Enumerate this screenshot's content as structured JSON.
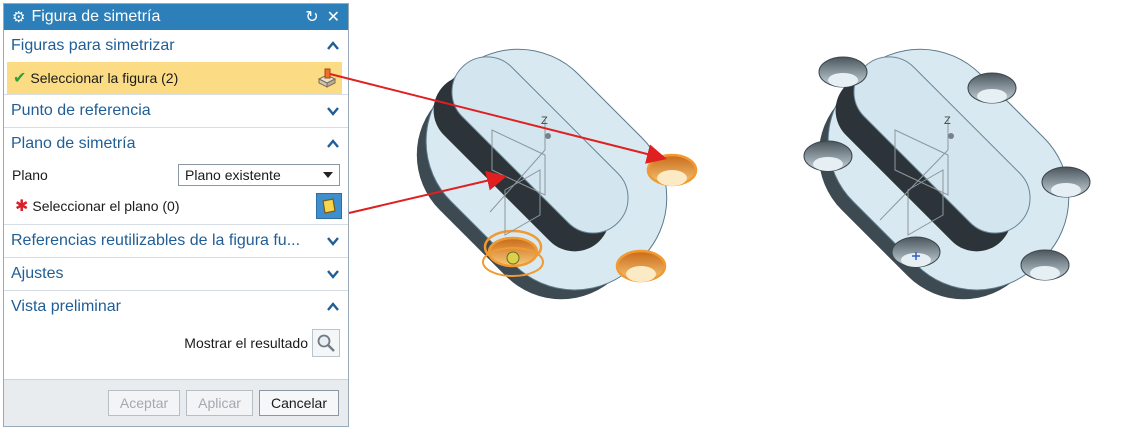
{
  "dialog": {
    "title": "Figura de simetría",
    "sections": {
      "figures": {
        "label": "Figuras para simetrizar",
        "select_label": "Seleccionar la figura (2)"
      },
      "reference_point": {
        "label": "Punto de referencia"
      },
      "symmetry_plane": {
        "label": "Plano de simetría",
        "plane_label": "Plano",
        "plane_value": "Plano existente",
        "select_label": "Seleccionar el plano (0)"
      },
      "reusable_refs": {
        "label": "Referencias reutilizables de la figura fu..."
      },
      "settings": {
        "label": "Ajustes"
      },
      "preview": {
        "label": "Vista preliminar",
        "show_result_label": "Mostrar el resultado"
      }
    },
    "buttons": {
      "accept": "Aceptar",
      "apply": "Aplicar",
      "cancel": "Cancelar"
    }
  },
  "viewport": {
    "axis_label": "Z"
  },
  "colors": {
    "title_bar": "#2d7fb9",
    "section_text": "#1f5e96",
    "active_row": "#fbdc84",
    "part_face": "#d8e9f2",
    "part_side": "#4b5962",
    "highlight": "#f0a34a",
    "arrow": "#e02020"
  }
}
